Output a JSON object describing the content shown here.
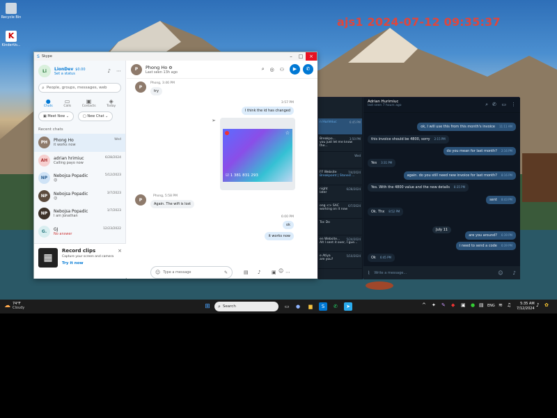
{
  "desktop": {
    "watermark": "ajs1 2024-07-12 09:35:37",
    "icons": [
      {
        "label": "Recycle Bin",
        "icon": "recycle-bin-icon"
      },
      {
        "label": "KinderVo...",
        "icon": "app-icon"
      }
    ]
  },
  "skype": {
    "window_title": "Skype",
    "profile": {
      "name": "LionDev",
      "balance": "$0.00",
      "status": "Set a status",
      "initials": "Li"
    },
    "search_placeholder": "People, groups, messages, web",
    "tabs": [
      {
        "label": "Chats",
        "icon": "chat-icon"
      },
      {
        "label": "Calls",
        "icon": "phone-icon"
      },
      {
        "label": "Contacts",
        "icon": "contacts-icon"
      },
      {
        "label": "Today",
        "icon": "today-icon"
      }
    ],
    "meet_now": "Meet Now",
    "new_chat": "New Chat",
    "recent_label": "Recent chats",
    "chats": [
      {
        "name": "Phong Ho",
        "preview": "it works now",
        "date": "Wed",
        "initials": "PH"
      },
      {
        "name": "adrian hrimiuc",
        "preview": "Calling payo now",
        "date": "6/28/2024",
        "initials": "AH"
      },
      {
        "name": "Nebojsa Popadic",
        "preview": "😊",
        "date": "5/12/2023",
        "initials": "NP"
      },
      {
        "name": "Nebojsa Popadic",
        "preview": "😉",
        "date": "3/7/2023",
        "initials": "NP"
      },
      {
        "name": "Nebojsa Popadic",
        "preview": "I am Jonathan",
        "date": "1/7/2023",
        "initials": "NP"
      },
      {
        "name": "GJ",
        "preview": "No answer",
        "date": "12/23/2022",
        "initials": "G."
      }
    ],
    "promo": {
      "title": "Record clips",
      "subtitle": "Capture your screen and camera",
      "link": "Try it now"
    },
    "chat_header": {
      "name": "Phong Ho",
      "last_seen": "Last seen 13h ago"
    },
    "messages": [
      {
        "meta": "Phong, 3:46 PM",
        "text": "try"
      },
      {
        "meta": "3:57 PM",
        "text": "I think the id has changed"
      },
      {
        "card_id": "1 381 831 293"
      },
      {
        "meta": "Phong, 5:58 PM",
        "text": "Again. The wifi is lost"
      },
      {
        "meta": "6:00 PM",
        "text": "ok"
      },
      {
        "text": "it works now"
      }
    ],
    "compose_placeholder": "Type a message"
  },
  "telegram": {
    "header": {
      "name": "Adrian Hurimiuc",
      "last_seen": "last seen 7 hours ago"
    },
    "list": [
      {
        "name": "n Hurimiuc",
        "date": "6:45 PM",
        "preview": ""
      },
      {
        "name": "Breakpo...",
        "date": "3:50 PM",
        "preview": "you just let me know the..."
      },
      {
        "name": "",
        "date": "Wed",
        "preview": ""
      },
      {
        "name": "FF Website",
        "date": "7/4/2024",
        "preview": "Breakpoint | Stoned ..."
      },
      {
        "name": "night",
        "date": "6/28/2024",
        "preview": "later"
      },
      {
        "name": "ong <> SAC",
        "date": "6/7/2024",
        "preview": "working on it now"
      },
      {
        "name": "Toc Do",
        "date": "",
        "preview": ""
      },
      {
        "name": "en Website...",
        "date": "5/24/2024",
        "preview": "Alt I sent it over, I gue..."
      },
      {
        "name": "e Atiya",
        "date": "5/10/2024",
        "preview": "are you?"
      }
    ],
    "messages": [
      {
        "text": "ok, I will use this from this month's invoice",
        "time": "11:11 AM",
        "me": true
      },
      {
        "text": "this invoice should be 4800, sorry",
        "time": "2:15 PM",
        "me": false
      },
      {
        "text": "do you mean for last month?",
        "time": "2:16 PM",
        "me": true
      },
      {
        "text": "Yes",
        "time": "3:31 PM",
        "me": false
      },
      {
        "text": "again. do you still need new invoice for last month?",
        "time": "8:16 PM",
        "me": true
      },
      {
        "text": "Yes. With the 4800 value and the new details",
        "time": "8:35 PM",
        "me": false
      },
      {
        "text": "sent",
        "time": "8:43 PM",
        "me": true
      },
      {
        "text": "Ok. Thx",
        "time": "8:52 PM",
        "me": false
      },
      {
        "text": "are you around?",
        "time": "6:39 PM",
        "me": true
      },
      {
        "text": "i need to send a code",
        "time": "6:39 PM",
        "me": true
      },
      {
        "text": "Ok",
        "time": "6:45 PM",
        "me": false
      }
    ],
    "date_divider": "July 11",
    "compose_placeholder": "Write a message..."
  },
  "taskbar": {
    "weather_temp": "74°F",
    "weather_desc": "Cloudy",
    "search": "Search",
    "lang": "ENG",
    "time": "5:35 AM",
    "date": "7/12/2024"
  }
}
